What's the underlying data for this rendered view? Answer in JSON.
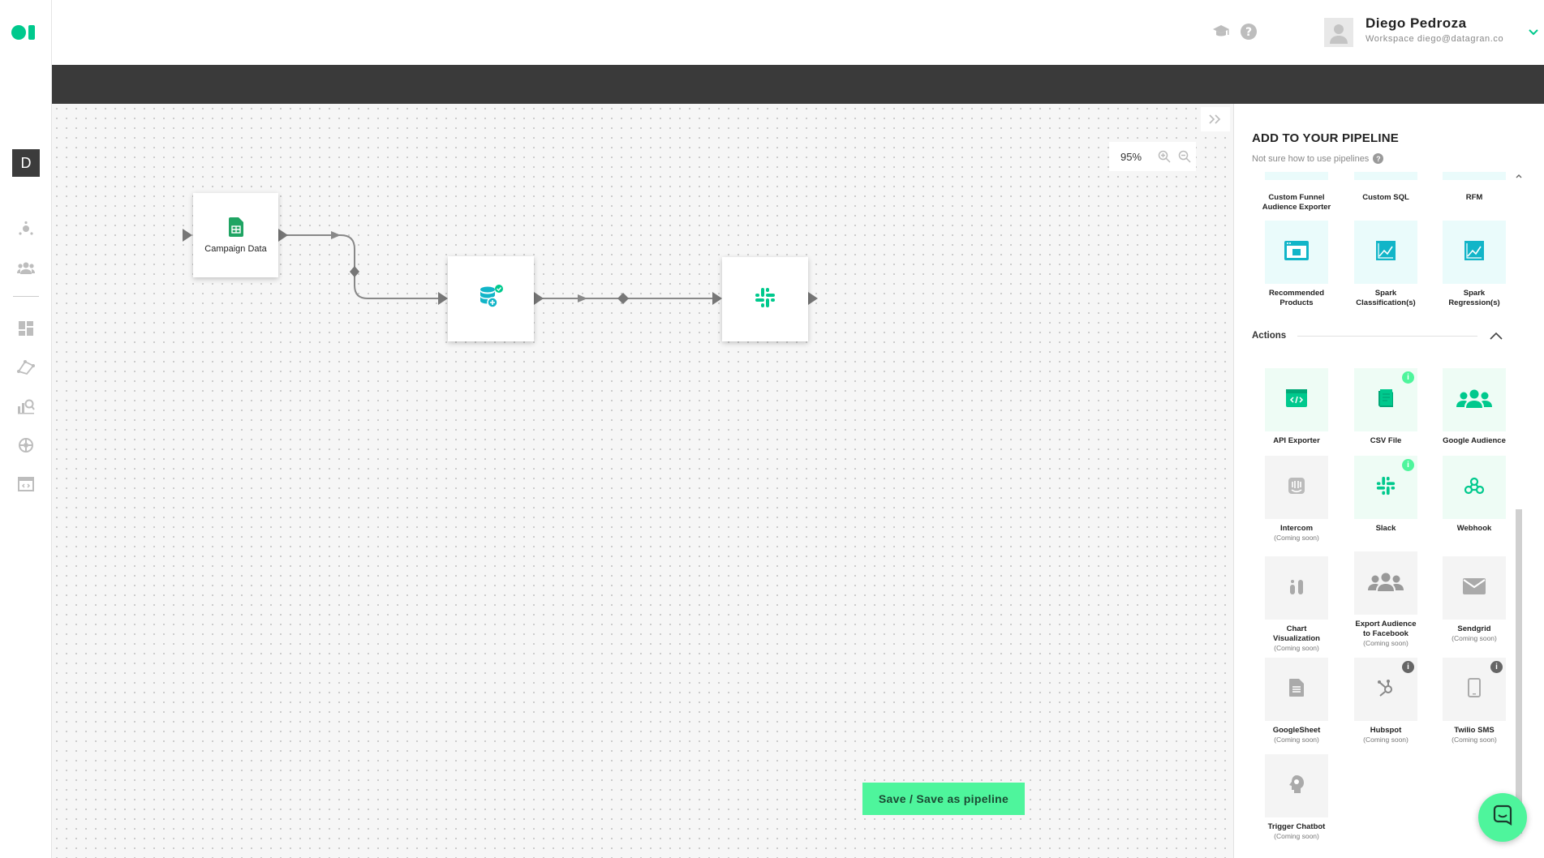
{
  "rail": {
    "workspace_initial": "D",
    "icons": [
      "network-icon",
      "users-icon",
      "dashboard-icon",
      "models-icon",
      "analytics-icon",
      "integrations-icon",
      "pipelines-icon"
    ]
  },
  "header": {
    "user_name": "Diego Pedroza",
    "user_workspace": "Workspace diego@datagran.co",
    "icons": [
      "graduation-cap-icon",
      "help-icon",
      "chevron-down-icon"
    ]
  },
  "canvas": {
    "zoom": "95%",
    "nodes": [
      {
        "id": "campaign-data",
        "label": "Campaign Data",
        "icon": "google-sheets-icon"
      },
      {
        "id": "data-transform",
        "label": "",
        "icon": "database-add-icon"
      },
      {
        "id": "slack-output",
        "label": "",
        "icon": "slack-icon"
      }
    ],
    "save_button": "Save / Save as pipeline"
  },
  "panel": {
    "title": "ADD TO YOUR PIPELINE",
    "help_text": "Not sure how to use pipelines",
    "model_row_labels": [
      "Custom Funnel Audience Exporter",
      "Custom SQL",
      "RFM"
    ],
    "models": [
      {
        "label": "Recommended Products",
        "sub": "",
        "icon": "recommended-products-icon"
      },
      {
        "label": "Spark Classification(s)",
        "sub": "",
        "icon": "spark-classification-icon"
      },
      {
        "label": "Spark Regression(s)",
        "sub": "",
        "icon": "spark-regression-icon"
      }
    ],
    "actions_title": "Actions",
    "actions": [
      {
        "label": "API Exporter",
        "sub": "",
        "icon": "api-exporter-icon",
        "badge": ""
      },
      {
        "label": "CSV File",
        "sub": "",
        "icon": "csv-file-icon",
        "badge": "i"
      },
      {
        "label": "Google Audience",
        "sub": "",
        "icon": "google-audience-icon",
        "badge": ""
      },
      {
        "label": "Intercom",
        "sub": "(Coming soon)",
        "icon": "intercom-icon",
        "badge": ""
      },
      {
        "label": "Slack",
        "sub": "",
        "icon": "slack-icon",
        "badge": "i"
      },
      {
        "label": "Webhook",
        "sub": "",
        "icon": "webhook-icon",
        "badge": ""
      },
      {
        "label": "Chart Visualization",
        "sub": "(Coming soon)",
        "icon": "chart-visualization-icon",
        "badge": ""
      },
      {
        "label": "Export Audience to Facebook",
        "sub": "(Coming soon)",
        "icon": "facebook-audience-icon",
        "badge": ""
      },
      {
        "label": "Sendgrid",
        "sub": "(Coming soon)",
        "icon": "sendgrid-icon",
        "badge": ""
      },
      {
        "label": "GoogleSheet",
        "sub": "(Coming soon)",
        "icon": "google-sheet-icon",
        "badge": ""
      },
      {
        "label": "Hubspot",
        "sub": "(Coming soon)",
        "icon": "hubspot-icon",
        "badge": "i"
      },
      {
        "label": "Twilio SMS",
        "sub": "(Coming soon)",
        "icon": "twilio-sms-icon",
        "badge": "i"
      },
      {
        "label": "Trigger Chatbot",
        "sub": "(Coming soon)",
        "icon": "trigger-chatbot-icon",
        "badge": ""
      }
    ]
  },
  "colors": {
    "brand_green": "#00c98d",
    "accent_green": "#4ef59c",
    "teal": "#12b5c8",
    "dark_bar": "#3a3a3a"
  }
}
